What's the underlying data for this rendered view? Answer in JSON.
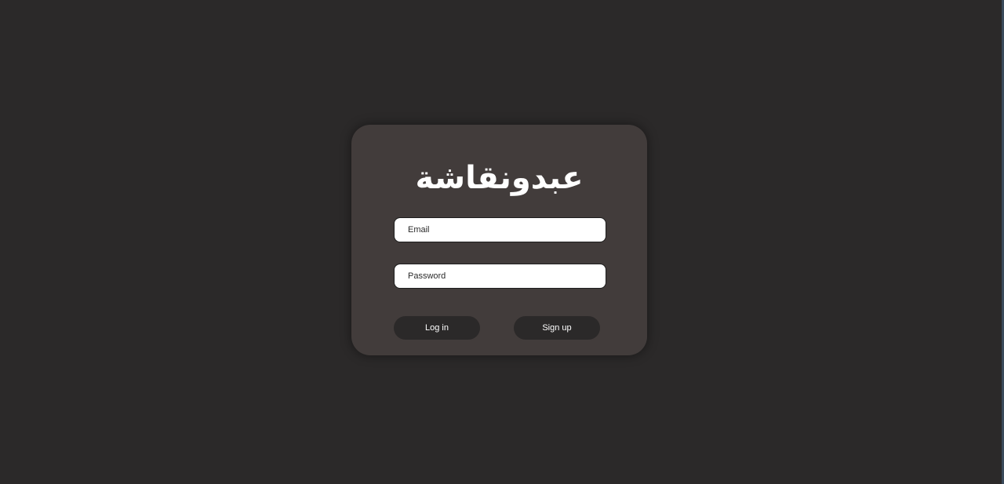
{
  "brand": {
    "logo_text": "عبدونقاشة"
  },
  "form": {
    "email_placeholder": "Email",
    "password_placeholder": "Password",
    "login_label": "Log in",
    "signup_label": "Sign up"
  },
  "colors": {
    "page_background": "#2b2929",
    "card_background": "#423c3b",
    "button_background": "#2b2929",
    "text_light": "#ffffff"
  }
}
